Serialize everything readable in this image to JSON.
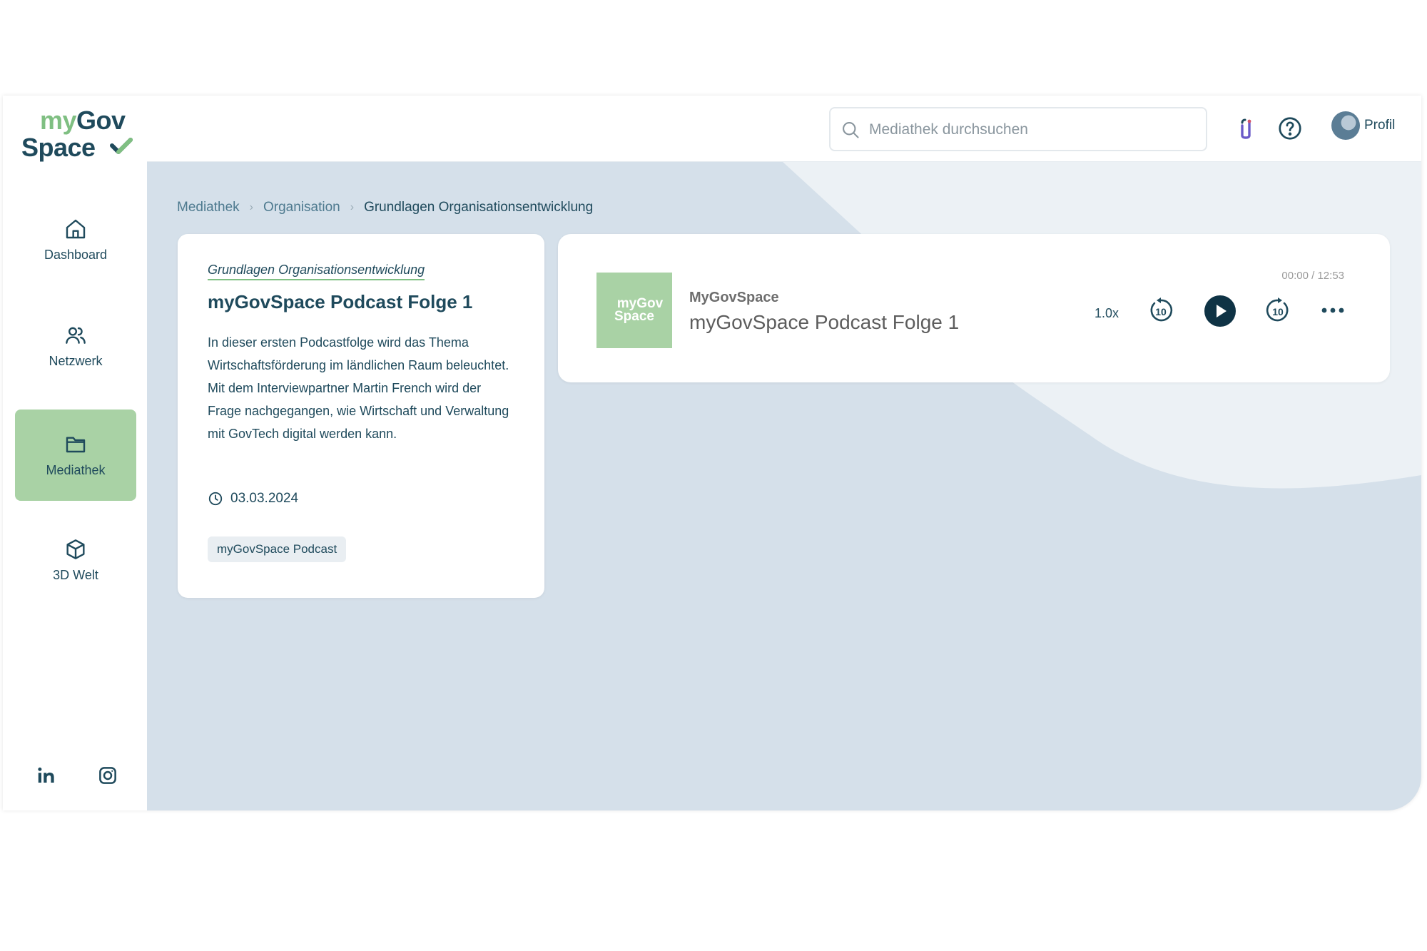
{
  "logo": {
    "my": "my",
    "gov": "Gov",
    "space": "Space"
  },
  "sidebar": {
    "items": [
      {
        "label": "Dashboard",
        "icon": "home-icon",
        "active": false
      },
      {
        "label": "Netzwerk",
        "icon": "users-icon",
        "active": false
      },
      {
        "label": "Mediathek",
        "icon": "folder-icon",
        "active": true
      },
      {
        "label": "3D Welt",
        "icon": "cube-icon",
        "active": false
      }
    ],
    "social": [
      "linkedin-icon",
      "instagram-icon"
    ]
  },
  "header": {
    "search_placeholder": "Mediathek durchsuchen",
    "profile_label": "Profil"
  },
  "breadcrumb": [
    "Mediathek",
    "Organisation",
    "Grundlagen Organisationsentwicklung"
  ],
  "episode_card": {
    "category": "Grundlagen Organisationsentwicklung",
    "title": "myGovSpace Podcast Folge 1",
    "description": "In dieser ersten Podcastfolge wird das Thema Wirtschaftsförderung im ländlichen Raum beleuchtet. Mit dem Interviewpartner Martin French wird der Frage nachgegangen, wie Wirtschaft und Verwaltung mit GovTech digital werden kann.",
    "date": "03.03.2024",
    "tag": "myGovSpace Podcast"
  },
  "player": {
    "cover_line1": "myGov",
    "cover_line2": "Space",
    "publisher": "MyGovSpace",
    "episode_title": "myGovSpace Podcast Folge 1",
    "time": "00:00 / 12:53",
    "speed": "1.0x",
    "skip_seconds": "10"
  },
  "colors": {
    "primary": "#1f4a5c",
    "accent_green": "#a9d2a5",
    "logo_green": "#7fbf82",
    "background": "#d5e0ea"
  }
}
